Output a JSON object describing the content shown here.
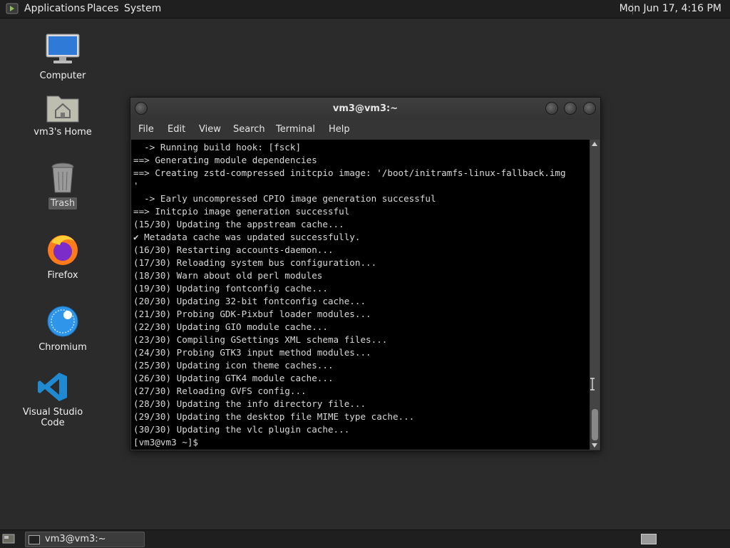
{
  "top_panel": {
    "menus": [
      "Applications",
      "Places",
      "System"
    ],
    "clock": "Mon Jun 17,  4:16 PM"
  },
  "desktop": {
    "icons": [
      {
        "label": "Computer",
        "icon": "computer-icon"
      },
      {
        "label": "vm3's Home",
        "icon": "home-folder-icon"
      },
      {
        "label": "Trash",
        "icon": "trash-icon",
        "selected": true
      },
      {
        "label": "Firefox",
        "icon": "firefox-icon"
      },
      {
        "label": "Chromium",
        "icon": "chromium-icon"
      },
      {
        "label": "Visual Studio Code",
        "icon": "vscode-icon"
      }
    ]
  },
  "terminal": {
    "title": "vm3@vm3:~",
    "menus": [
      "File",
      "Edit",
      "View",
      "Search",
      "Terminal",
      "Help"
    ],
    "lines": [
      "  -> Running build hook: [fsck]",
      "==> Generating module dependencies",
      "==> Creating zstd-compressed initcpio image: '/boot/initramfs-linux-fallback.img",
      "'",
      "  -> Early uncompressed CPIO image generation successful",
      "==> Initcpio image generation successful",
      "(15/30) Updating the appstream cache...",
      "✔ Metadata cache was updated successfully.",
      "(16/30) Restarting accounts-daemon...",
      "(17/30) Reloading system bus configuration...",
      "(18/30) Warn about old perl modules",
      "(19/30) Updating fontconfig cache...",
      "(20/30) Updating 32-bit fontconfig cache...",
      "(21/30) Probing GDK-Pixbuf loader modules...",
      "(22/30) Updating GIO module cache...",
      "(23/30) Compiling GSettings XML schema files...",
      "(24/30) Probing GTK3 input method modules...",
      "(25/30) Updating icon theme caches...",
      "(26/30) Updating GTK4 module cache...",
      "(27/30) Reloading GVFS config...",
      "(28/30) Updating the info directory file...",
      "(29/30) Updating the desktop file MIME type cache...",
      "(30/30) Updating the vlc plugin cache...",
      "[vm3@vm3 ~]$ "
    ]
  },
  "taskbar": {
    "tasks": [
      {
        "label": "vm3@vm3:~",
        "icon": "terminal-icon"
      }
    ]
  },
  "colors": {
    "desktop_bg": "#2b2b2b",
    "panel_bg": "#1f1f1f",
    "terminal_bg": "#000000",
    "terminal_fg": "#d8d8d8"
  }
}
